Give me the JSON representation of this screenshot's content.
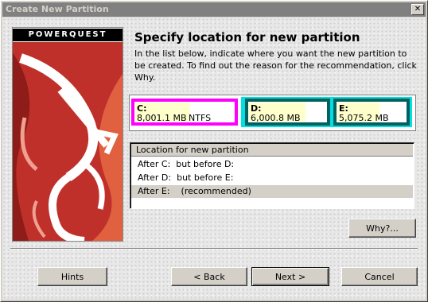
{
  "window": {
    "title": "Create New Partition",
    "close_glyph": "✕"
  },
  "logo": {
    "brand": "POWERQUEST"
  },
  "heading": "Specify location for new partition",
  "description": "In the list below, indicate where you want the new partition to be created.  To find out the reason for the recommendation, click Why.",
  "partitions": [
    {
      "letter": "C:",
      "size": "8,001.1 MB",
      "fs": "NTFS",
      "border_color": "#ff00ff",
      "used_fraction": 0.55
    },
    {
      "letter": "D:",
      "size": "6,000.8 MB",
      "fs": "",
      "border_color": "#006060",
      "used_fraction": 0.72
    },
    {
      "letter": "E:",
      "size": "5,075.2 MB",
      "fs": "",
      "border_color": "#006060",
      "used_fraction": 0.6
    }
  ],
  "location_list": {
    "header": "Location for new partition",
    "items": [
      {
        "label": "After C:  but before D:",
        "selected": false
      },
      {
        "label": "After D:  but before E:",
        "selected": false
      },
      {
        "label": "After E:    (recommended)",
        "selected": true
      }
    ]
  },
  "buttons": {
    "why": "Why?...",
    "hints": "Hints",
    "back": "< Back",
    "next": "Next >",
    "cancel": "Cancel"
  },
  "colors": {
    "extended_partition": "#00e0e0",
    "used_space": "#ffffcc"
  }
}
